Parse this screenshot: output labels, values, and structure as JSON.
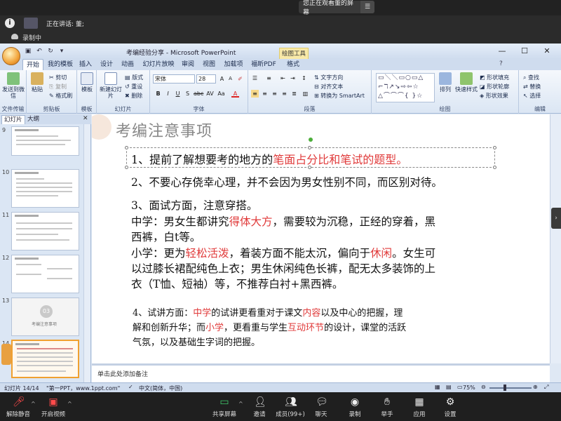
{
  "meeting": {
    "share_banner": "您正在观看董的屏幕",
    "menu_icon": "☰",
    "speaking_label": "正在讲话: 董;",
    "recording_label": "录制中",
    "toolbar": [
      {
        "label": "解除静音",
        "icon": "mic-muted-icon"
      },
      {
        "label": "开启视频",
        "icon": "video-off-icon"
      },
      {
        "label": "共享屏幕",
        "icon": "share-screen-icon"
      },
      {
        "label": "邀请",
        "icon": "invite-icon"
      },
      {
        "label": "成员(99+)",
        "icon": "members-icon"
      },
      {
        "label": "聊天",
        "icon": "chat-icon"
      },
      {
        "label": "录制",
        "icon": "record-icon"
      },
      {
        "label": "举手",
        "icon": "raise-hand-icon"
      },
      {
        "label": "应用",
        "icon": "apps-icon"
      },
      {
        "label": "设置",
        "icon": "settings-icon"
      }
    ]
  },
  "ppt": {
    "window_title": "考编经验分享 - Microsoft PowerPoint",
    "context_tools": "绘图工具",
    "tabs": [
      "开始",
      "我的模板",
      "插入",
      "设计",
      "动画",
      "幻灯片放映",
      "审阅",
      "视图",
      "加载项",
      "福昕PDF",
      "格式"
    ],
    "active_tab": "开始",
    "groups": {
      "send": {
        "label": "文件传输",
        "button": "发送到微信"
      },
      "clipboard": {
        "label": "剪贴板",
        "paste": "粘贴",
        "cut": "剪切",
        "copy": "复制",
        "format_painter": "格式刷"
      },
      "template": {
        "label": "模板",
        "button": "模板"
      },
      "slides": {
        "label": "幻灯片",
        "new": "新建幻灯片",
        "layout": "版式",
        "reset": "重设",
        "delete": "删除"
      },
      "font": {
        "label": "字体",
        "font_name": "宋体",
        "font_size": "28"
      },
      "paragraph": {
        "label": "段落",
        "text_direction": "文字方向",
        "align_text": "对齐文本",
        "smartart": "转换为 SmartArt"
      },
      "drawing": {
        "label": "绘图",
        "arrange": "排列",
        "quick_styles": "快速样式",
        "shape_fill": "形状填充",
        "shape_outline": "形状轮廓",
        "shape_effects": "形状效果"
      },
      "editing": {
        "label": "编辑",
        "find": "查找",
        "replace": "替换",
        "select": "选择"
      }
    },
    "panel_tabs": [
      "幻灯片",
      "大纲"
    ],
    "slide_numbers": [
      "9",
      "10",
      "11",
      "12",
      "13",
      "14"
    ],
    "section_thumb": {
      "number": "03",
      "caption": "考编注意事项"
    },
    "notes_placeholder": "单击此处添加备注",
    "status": {
      "slide_counter": "幻灯片 14/14",
      "theme": "\"第一PPT，www.1ppt.com\"",
      "language": "中文(简体，中国)",
      "zoom": "75%"
    }
  },
  "slide": {
    "title": "考编注意事项",
    "item1": {
      "a": "1、提前了解想要考的地方的",
      "b": "笔面占分比和笔试的题型。"
    },
    "item2": "2、不要心存侥幸心理，并不会因为男女性别不同，而区别对待。",
    "item3": {
      "heading": "3、面试方面，注意穿搭。",
      "middle_a": "中学：男女生都讲究",
      "middle_b": "得体大方",
      "middle_c": "，需要较为沉稳，正经的穿着，黑",
      "middle_d": "西裤，白t等。",
      "primary_a": "小学：更为",
      "primary_b": "轻松活泼",
      "primary_c": "，着装方面不能太沉，偏向于",
      "primary_d": "休闲",
      "primary_e": "。女生可",
      "primary_f": "以过膝长裙配纯色上衣；男生休闲纯色长裤，配无太多装饰的上",
      "primary_g": "衣（T恤、短袖）等，不推荐白衬+黑西裤。"
    },
    "item4": {
      "a": "4、试讲方面：",
      "b": "中学",
      "c": "的试讲更看重对于课文",
      "d": "内容",
      "e": "以及中心的把握，理",
      "f": "解和创新升华；而",
      "g": "小学",
      "h": "，更看重与学生",
      "i": "互动环节",
      "j": "的设计，课堂的活跃",
      "k": "气氛，以及基础生字词的把握。"
    }
  },
  "colors": {
    "accent_red": "#e03a3a",
    "ribbon_blue": "#dbe6f4",
    "meeting_dark": "#1f1f1f"
  }
}
